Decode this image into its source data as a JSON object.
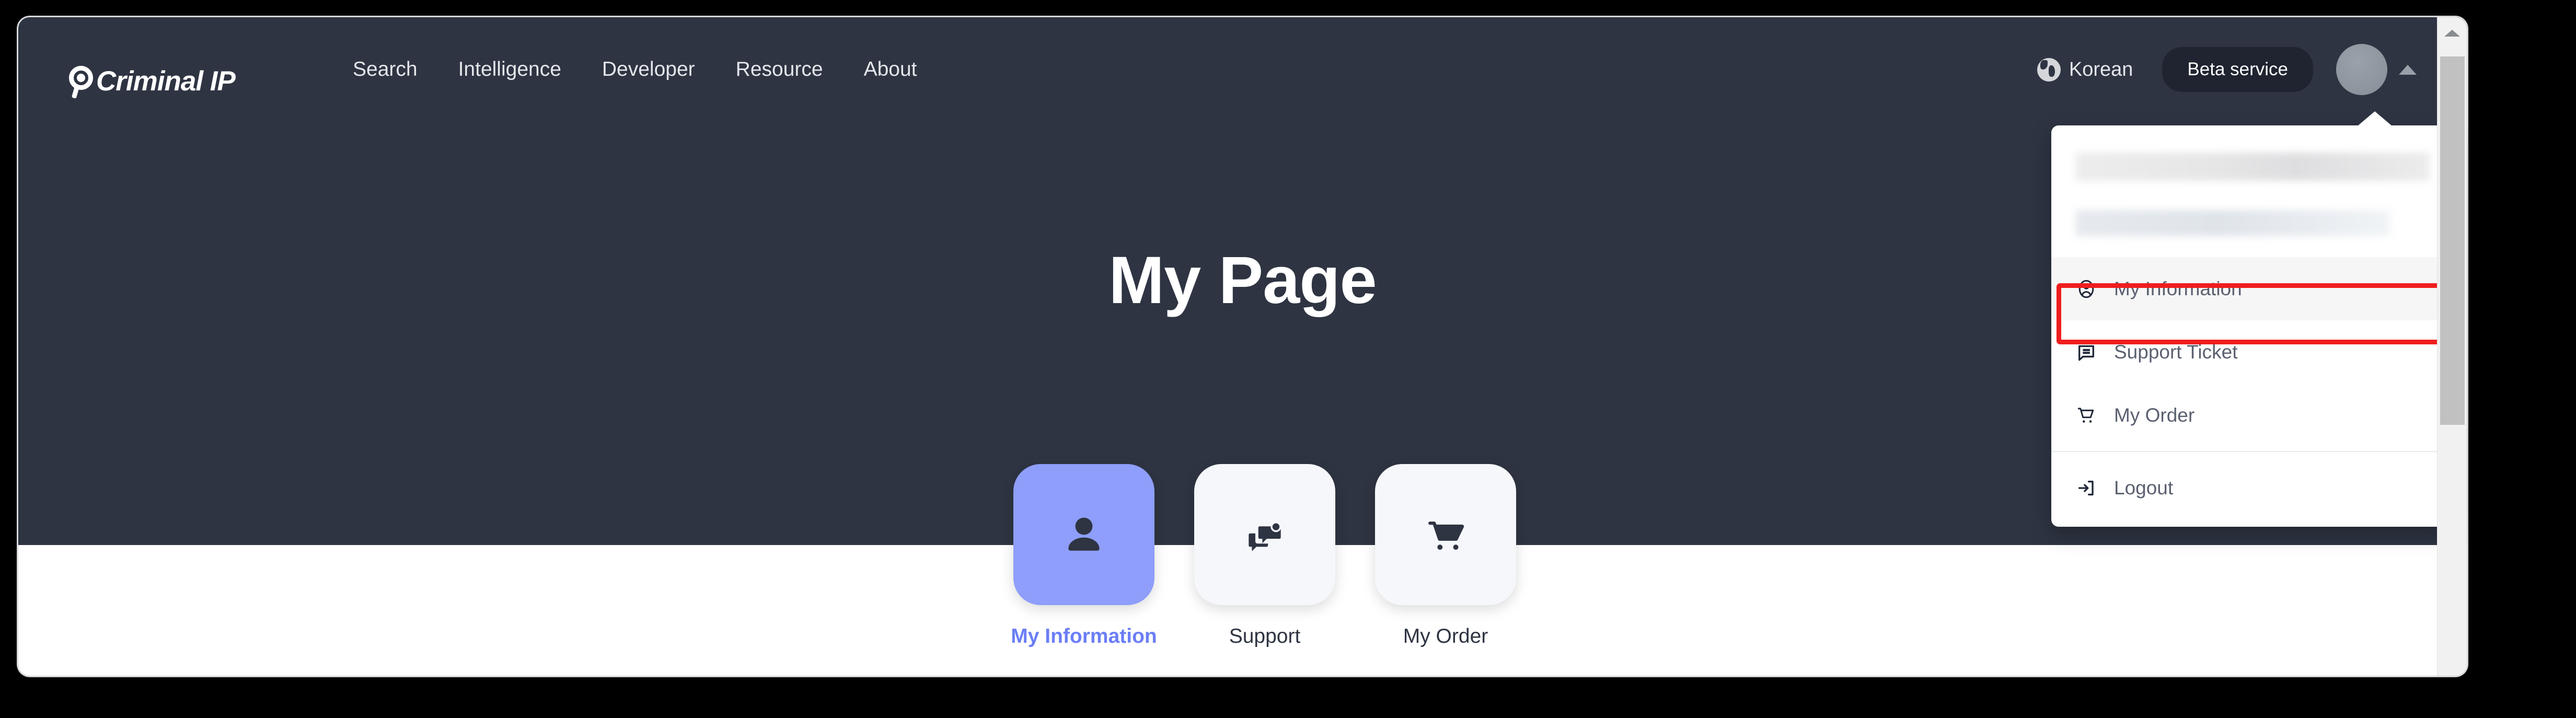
{
  "brand": {
    "name": "Criminal IP",
    "logo_icon": "magnifier-logo-icon"
  },
  "header": {
    "nav": [
      {
        "label": "Search",
        "name": "search"
      },
      {
        "label": "Intelligence",
        "name": "intelligence"
      },
      {
        "label": "Developer",
        "name": "developer"
      },
      {
        "label": "Resource",
        "name": "resource"
      },
      {
        "label": "About",
        "name": "about"
      }
    ],
    "language": {
      "label": "Korean",
      "icon": "globe-icon"
    },
    "beta_button": "Beta service",
    "avatar_icon": "avatar-icon",
    "caret_icon": "caret-up-icon"
  },
  "hero": {
    "title": "My Page"
  },
  "tiles": [
    {
      "label": "My Information",
      "icon": "person-icon",
      "active": true
    },
    {
      "label": "Support",
      "icon": "forum-icon",
      "active": false
    },
    {
      "label": "My Order",
      "icon": "shopping-cart-icon",
      "active": false
    }
  ],
  "dropdown": {
    "user_name_masked": "",
    "user_email_masked": "",
    "items": [
      {
        "label": "My Information",
        "icon": "account-circle-icon",
        "highlighted": true
      },
      {
        "label": "Support Ticket",
        "icon": "message-icon",
        "highlighted": false
      },
      {
        "label": "My Order",
        "icon": "cart-icon",
        "highlighted": false
      },
      {
        "label": "Logout",
        "icon": "logout-icon",
        "highlighted": false
      }
    ]
  },
  "annotation": {
    "highlight_color": "#ef1d1d",
    "target": "My Information"
  },
  "colors": {
    "hero_bg": "#2e3442",
    "accent_blue": "#6b7ef6",
    "tile_active_bg": "#8e9efa",
    "beta_bg": "#1f2430",
    "page_bg": "#ffffff"
  },
  "scrollbar": {
    "up_arrow_icon": "scroll-up-arrow-icon",
    "thumb": "scroll-thumb"
  }
}
